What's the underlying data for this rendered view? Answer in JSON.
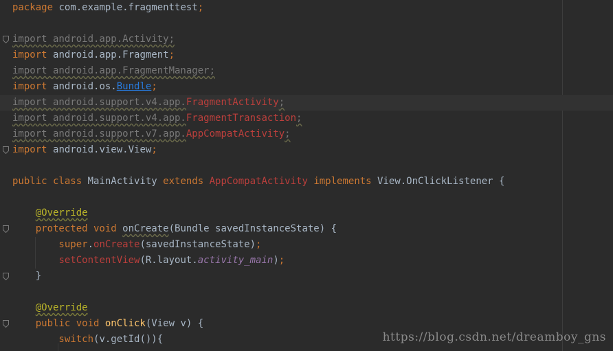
{
  "editor": {
    "lines": [
      {
        "tokens": [
          {
            "t": "package ",
            "c": "kw"
          },
          {
            "t": "com.example.fragmenttest",
            "c": "plain"
          },
          {
            "t": ";",
            "c": "semi"
          }
        ]
      },
      {
        "tokens": []
      },
      {
        "fold": true,
        "tokens": [
          {
            "t": "import android.app.Activity;",
            "c": "unused"
          }
        ]
      },
      {
        "tokens": [
          {
            "t": "import ",
            "c": "kw"
          },
          {
            "t": "android.app.Fragment",
            "c": "plain"
          },
          {
            "t": ";",
            "c": "semi"
          }
        ]
      },
      {
        "tokens": [
          {
            "t": "import android.app.FragmentManager;",
            "c": "unused"
          }
        ]
      },
      {
        "tokens": [
          {
            "t": "import ",
            "c": "kw"
          },
          {
            "t": "android.os.",
            "c": "plain"
          },
          {
            "t": "Bundle",
            "c": "link"
          },
          {
            "t": ";",
            "c": "semi"
          }
        ]
      },
      {
        "caret": true,
        "tokens": [
          {
            "t": "import android.support.v4.app.",
            "c": "unused"
          },
          {
            "t": "FragmentActivity",
            "c": "err"
          },
          {
            "t": ";",
            "c": "unused"
          }
        ]
      },
      {
        "tokens": [
          {
            "t": "import android.support.v4.app.",
            "c": "unused"
          },
          {
            "t": "FragmentTransaction",
            "c": "err"
          },
          {
            "t": ";",
            "c": "unused"
          }
        ]
      },
      {
        "tokens": [
          {
            "t": "import android.support.v7.app.",
            "c": "unused"
          },
          {
            "t": "AppCompatActivity",
            "c": "err"
          },
          {
            "t": ";",
            "c": "unused"
          }
        ]
      },
      {
        "fold": true,
        "tokens": [
          {
            "t": "import ",
            "c": "kw"
          },
          {
            "t": "android.view.View",
            "c": "plain"
          },
          {
            "t": ";",
            "c": "semi"
          }
        ]
      },
      {
        "tokens": []
      },
      {
        "tokens": [
          {
            "t": "public class ",
            "c": "kw"
          },
          {
            "t": "MainActivity ",
            "c": "plain"
          },
          {
            "t": "extends ",
            "c": "kw"
          },
          {
            "t": "AppCompatActivity ",
            "c": "err"
          },
          {
            "t": "implements ",
            "c": "kw"
          },
          {
            "t": "View.OnClickListener {",
            "c": "plain"
          }
        ]
      },
      {
        "tokens": []
      },
      {
        "tokens": [
          {
            "t": "    ",
            "c": "plain"
          },
          {
            "t": "@Override",
            "c": "ann"
          }
        ]
      },
      {
        "fold": true,
        "tokens": [
          {
            "t": "    protected void ",
            "c": "kw"
          },
          {
            "t": "onCreate",
            "c": "methodu"
          },
          {
            "t": "(Bundle savedInstanceState) {",
            "c": "plain"
          }
        ]
      },
      {
        "tokens": [
          {
            "t": "        super",
            "c": "kw"
          },
          {
            "t": ".",
            "c": "plain"
          },
          {
            "t": "onCreate",
            "c": "call"
          },
          {
            "t": "(savedInstanceState)",
            "c": "plain"
          },
          {
            "t": ";",
            "c": "semi"
          }
        ]
      },
      {
        "tokens": [
          {
            "t": "        ",
            "c": "plain"
          },
          {
            "t": "setContentView",
            "c": "call"
          },
          {
            "t": "(R.layout.",
            "c": "plain"
          },
          {
            "t": "activity_main",
            "c": "field"
          },
          {
            "t": ")",
            "c": "plain"
          },
          {
            "t": ";",
            "c": "semi"
          }
        ]
      },
      {
        "fold": true,
        "tokens": [
          {
            "t": "    }",
            "c": "plain"
          }
        ]
      },
      {
        "tokens": []
      },
      {
        "tokens": [
          {
            "t": "    ",
            "c": "plain"
          },
          {
            "t": "@Override",
            "c": "ann"
          }
        ]
      },
      {
        "fold": true,
        "tokens": [
          {
            "t": "    public void ",
            "c": "kw"
          },
          {
            "t": "onClick",
            "c": "method"
          },
          {
            "t": "(View v) {",
            "c": "plain"
          }
        ]
      },
      {
        "tokens": [
          {
            "t": "        switch",
            "c": "kw"
          },
          {
            "t": "(v.getId()){",
            "c": "plain"
          }
        ]
      }
    ]
  },
  "watermark": "https://blog.csdn.net/dreamboy_gns"
}
